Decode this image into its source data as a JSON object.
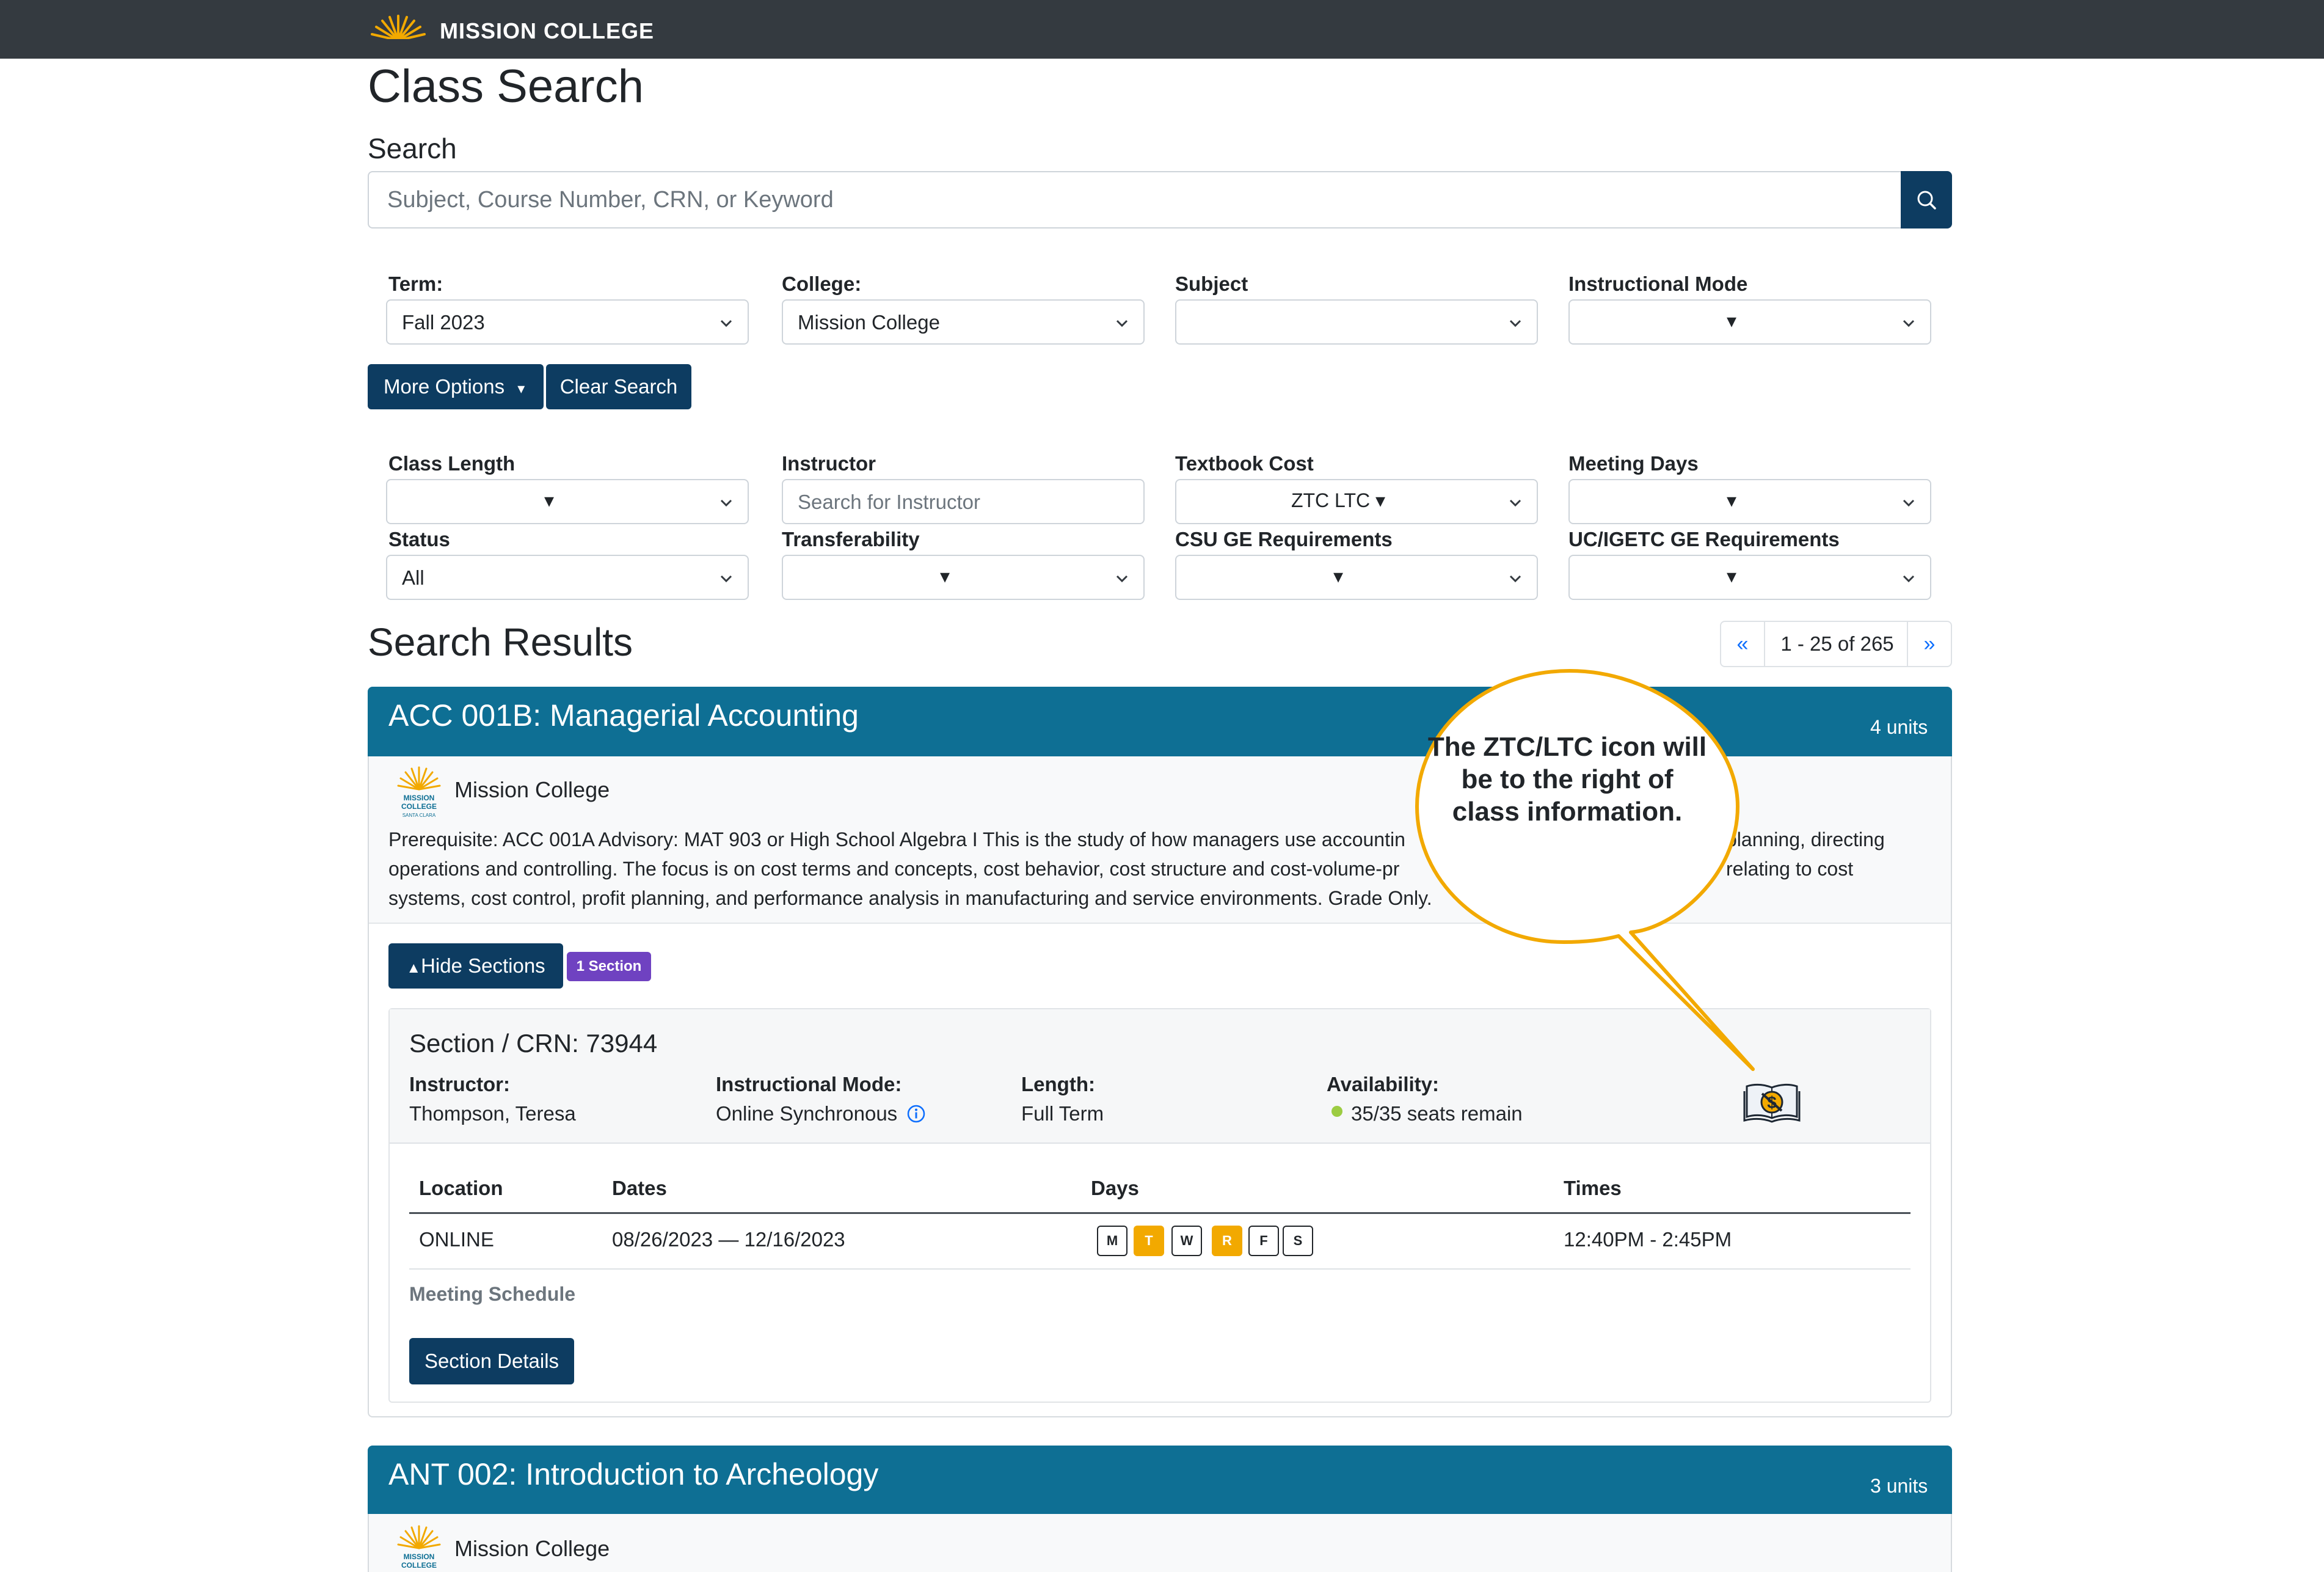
{
  "header": {
    "logo_text": "MISSION COLLEGE",
    "bg": "#343a40"
  },
  "page": {
    "title": "Class Search"
  },
  "search": {
    "heading": "Search",
    "placeholder": "Subject, Course Number, CRN, or Keyword"
  },
  "filters": {
    "term": {
      "label": "Term:",
      "value": "Fall 2023"
    },
    "college": {
      "label": "College:",
      "value": "Mission College"
    },
    "subject": {
      "label": "Subject",
      "value": ""
    },
    "instructional_mode": {
      "label": "Instructional Mode",
      "value": ""
    },
    "more_options": "More Options",
    "clear_search": "Clear Search",
    "class_length": {
      "label": "Class Length",
      "value": ""
    },
    "instructor": {
      "label": "Instructor",
      "placeholder": "Search for Instructor"
    },
    "textbook_cost": {
      "label": "Textbook Cost",
      "value": "ZTC LTC"
    },
    "meeting_days": {
      "label": "Meeting Days",
      "value": ""
    },
    "status": {
      "label": "Status",
      "value": "All"
    },
    "transferability": {
      "label": "Transferability",
      "value": ""
    },
    "csu_ge": {
      "label": "CSU GE Requirements",
      "value": ""
    },
    "uc_igetc": {
      "label": "UC/IGETC GE Requirements",
      "value": ""
    }
  },
  "results": {
    "heading": "Search Results",
    "pagination": {
      "prev": "«",
      "info": "1 - 25 of 265",
      "next": "»"
    }
  },
  "courses": [
    {
      "title": "ACC 001B: Managerial Accounting",
      "units": "4 units",
      "college": "Mission College",
      "logo_text": [
        "MISSION",
        "COLLEGE",
        "SANTA CLARA"
      ],
      "description": "Prerequisite: ACC 001A Advisory: MAT 903 or High School Algebra I This is the study of how managers use accountin",
      "description_right_1": "planning, directing",
      "description_line2_left": "operations and controlling. The focus is on cost terms and concepts, cost behavior, cost structure and cost-volume-pr",
      "description_right_2": "relating to cost",
      "description_line3": "systems, cost control, profit planning, and performance analysis in manufacturing and service environments. Grade Only.",
      "hide_sections": "Hide Sections",
      "section_badge": "1 Section",
      "section": {
        "title": "Section / CRN: 73944",
        "instructor_label": "Instructor:",
        "instructor": "Thompson, Teresa",
        "mode_label": "Instructional Mode:",
        "mode": "Online Synchronous",
        "length_label": "Length:",
        "length": "Full Term",
        "availability_label": "Availability:",
        "availability": "35/35 seats remain",
        "textbook_icon": "ztc-ltc-textbook-icon",
        "table": {
          "headers": {
            "location": "Location",
            "dates": "Dates",
            "days": "Days",
            "times": "Times"
          },
          "row": {
            "location": "ONLINE",
            "dates": "08/26/2023 — 12/16/2023",
            "times": "12:40PM - 2:45PM"
          },
          "days": [
            {
              "label": "M",
              "active": false
            },
            {
              "label": "T",
              "active": true
            },
            {
              "label": "W",
              "active": false
            },
            {
              "label": "R",
              "active": true
            },
            {
              "label": "F",
              "active": false
            },
            {
              "label": "S",
              "active": false
            }
          ]
        },
        "meeting_schedule": "Meeting Schedule",
        "details_button": "Section Details"
      }
    },
    {
      "title": "ANT 002: Introduction to Archeology",
      "units": "3 units",
      "college": "Mission College",
      "logo_text": [
        "MISSION",
        "COLLEGE"
      ]
    }
  ],
  "callout": {
    "text": "The ZTC/LTC icon will be to the right of class information."
  },
  "colors": {
    "primary": "#0d3c61",
    "card_header": "#0e6f94",
    "badge": "#6f42c1",
    "day_active": "#f2a900",
    "callout_border": "#f2a900",
    "available_dot": "#9ccc42"
  }
}
